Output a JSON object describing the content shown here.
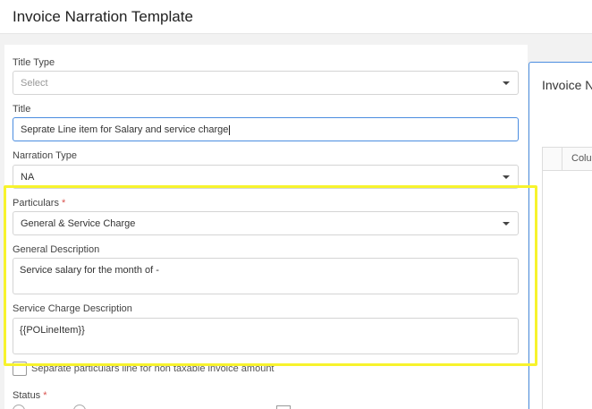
{
  "header": {
    "title": "Invoice Narration Template"
  },
  "form": {
    "title_type": {
      "label": "Title Type",
      "placeholder": "Select"
    },
    "title": {
      "label": "Title",
      "value": "Seprate Line item for Salary and service charge"
    },
    "narration_type": {
      "label": "Narration Type",
      "value": "NA"
    },
    "particulars": {
      "label": "Particulars",
      "required": "*",
      "value": "General & Service Charge"
    },
    "general_description": {
      "label": "General Description",
      "value": "Service salary for the month of -"
    },
    "service_charge_description": {
      "label": "Service Charge Description",
      "value": "{{POLineItem}}"
    },
    "separate_particulars": {
      "label": "Separate particulars line for non taxable invoice amount"
    },
    "status": {
      "label": "Status",
      "required": "*"
    }
  },
  "right_panel": {
    "title": "Invoice N",
    "column_header": "Colun"
  },
  "colors": {
    "highlight": "#f7f32c",
    "accent": "#4b8de0",
    "required": "#d9534f"
  }
}
